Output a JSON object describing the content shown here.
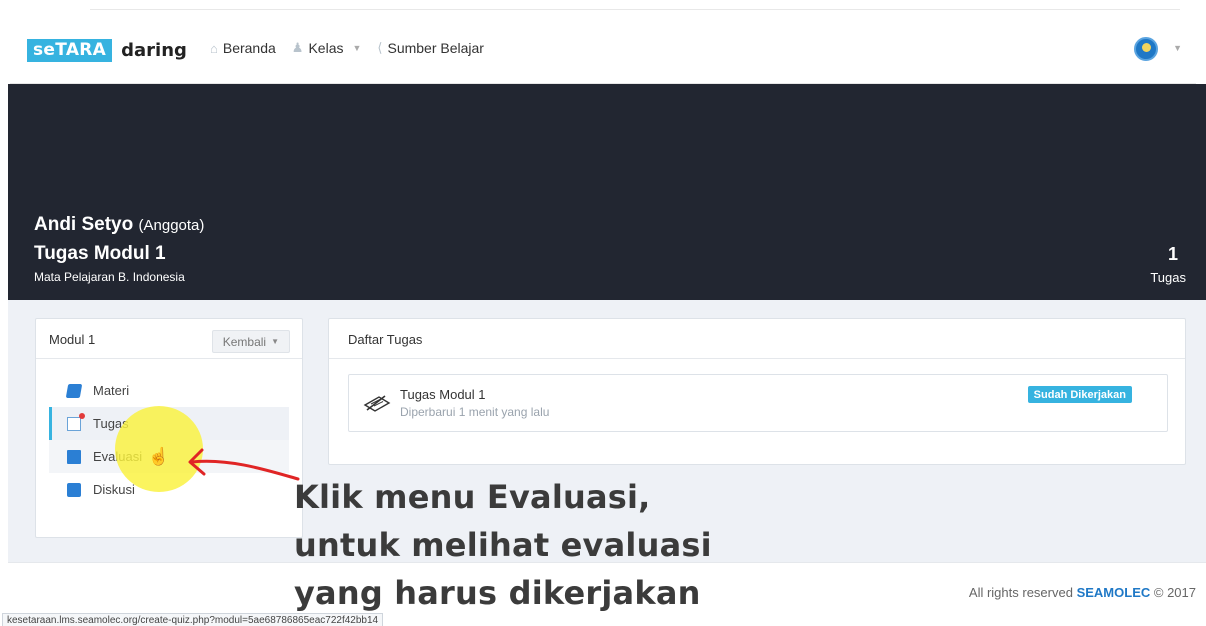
{
  "navbar": {
    "logo_part1": "seTARA",
    "logo_part2": "daring",
    "items": [
      {
        "label": "Beranda",
        "icon": "home-icon"
      },
      {
        "label": "Kelas",
        "icon": "users-icon"
      },
      {
        "label": "Sumber Belajar",
        "icon": "share-icon"
      }
    ]
  },
  "hero": {
    "user_name": "Andi Setyo",
    "user_role": "(Anggota)",
    "module_title": "Tugas Modul 1",
    "subject": "Mata Pelajaran B. Indonesia",
    "task_count": "1",
    "task_count_label": "Tugas"
  },
  "sidebar": {
    "title": "Modul 1",
    "back_button": "Kembali",
    "items": [
      {
        "label": "Materi",
        "icon": "book-icon"
      },
      {
        "label": "Tugas",
        "icon": "document-icon"
      },
      {
        "label": "Evaluasi",
        "icon": "clipboard-icon"
      },
      {
        "label": "Diskusi",
        "icon": "chat-icon"
      }
    ]
  },
  "tasks": {
    "title": "Daftar Tugas",
    "items": [
      {
        "title": "Tugas Modul 1",
        "updated": "Diperbarui 1 menit yang lalu",
        "status": "Sudah Dikerjakan"
      }
    ]
  },
  "footer": {
    "text": "All rights reserved",
    "brand": "SEAMOLEC",
    "copyright": "© 2017"
  },
  "status_bar_url": "kesetaraan.lms.seamolec.org/create-quiz.php?modul=5ae68786865eac722f42bb14",
  "annotation": {
    "lines": [
      "Klik menu Evaluasi,",
      "untuk melihat evaluasi",
      "yang harus dikerjakan"
    ]
  },
  "colors": {
    "accent": "#36b3e0",
    "hero_bg": "#222631",
    "brand_link": "#1f78c6",
    "highlight": "#faf23c",
    "arrow": "#e02525"
  }
}
